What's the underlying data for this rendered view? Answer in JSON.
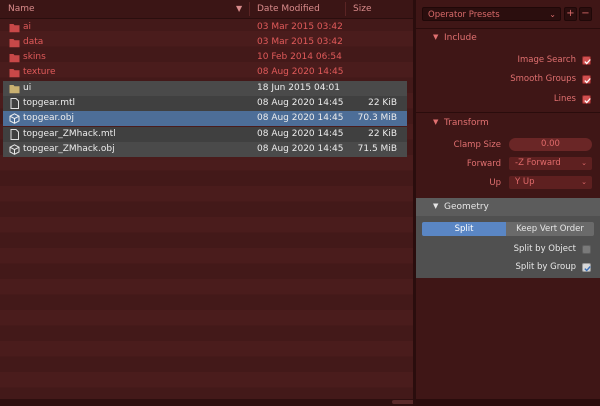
{
  "columns": {
    "name": "Name",
    "date": "Date Modified",
    "size": "Size"
  },
  "files": [
    {
      "name": "ai",
      "date": "03 Mar 2015 03:42",
      "size": "",
      "type": "folder"
    },
    {
      "name": "data",
      "date": "03 Mar 2015 03:42",
      "size": "",
      "type": "folder"
    },
    {
      "name": "skins",
      "date": "10 Feb 2014 06:54",
      "size": "",
      "type": "folder"
    },
    {
      "name": "texture",
      "date": "08 Aug 2020 14:45",
      "size": "",
      "type": "folder"
    },
    {
      "name": "ui",
      "date": "18 Jun 2015 04:01",
      "size": "",
      "type": "folder"
    },
    {
      "name": "topgear.mtl",
      "date": "08 Aug 2020 14:45",
      "size": "22 KiB",
      "type": "file"
    },
    {
      "name": "topgear.obj",
      "date": "08 Aug 2020 14:45",
      "size": "70.3 MiB",
      "type": "mesh",
      "selected": true
    },
    {
      "name": "topgear_ZMhack.mtl",
      "date": "08 Aug 2020 14:45",
      "size": "22 KiB",
      "type": "file"
    },
    {
      "name": "topgear_ZMhack.obj",
      "date": "08 Aug 2020 14:45",
      "size": "71.5 MiB",
      "type": "mesh"
    }
  ],
  "presets": {
    "label": "Operator Presets",
    "add": "+",
    "remove": "−"
  },
  "include": {
    "title": "Include",
    "options": [
      {
        "label": "Image Search",
        "checked": true
      },
      {
        "label": "Smooth Groups",
        "checked": true
      },
      {
        "label": "Lines",
        "checked": true
      }
    ]
  },
  "transform": {
    "title": "Transform",
    "clamp_label": "Clamp Size",
    "clamp_value": "0.00",
    "forward_label": "Forward",
    "forward_value": "-Z Forward",
    "up_label": "Up",
    "up_value": "Y Up"
  },
  "geometry": {
    "title": "Geometry",
    "split": "Split",
    "keep_vert_order": "Keep Vert Order",
    "split_by_object": "Split by Object",
    "split_by_object_checked": false,
    "split_by_group": "Split by Group",
    "split_by_group_checked": true
  },
  "colors": {
    "accent_red": "#e05a5a",
    "selection_blue": "#4d6e98",
    "split_blue": "#5a86c4"
  }
}
